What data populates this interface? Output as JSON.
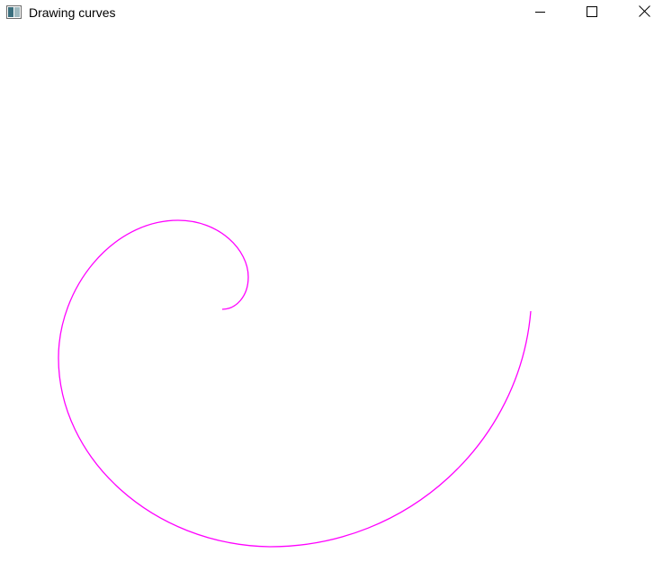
{
  "window": {
    "title": "Drawing curves",
    "icon": "app-window-icon",
    "controls": {
      "minimize_icon": "minimize-icon",
      "maximize_icon": "maximize-icon",
      "close_icon": "close-icon"
    }
  },
  "canvas": {
    "background": "#ffffff",
    "curve": {
      "shape": "spiral",
      "color": "#ff00ff"
    }
  }
}
